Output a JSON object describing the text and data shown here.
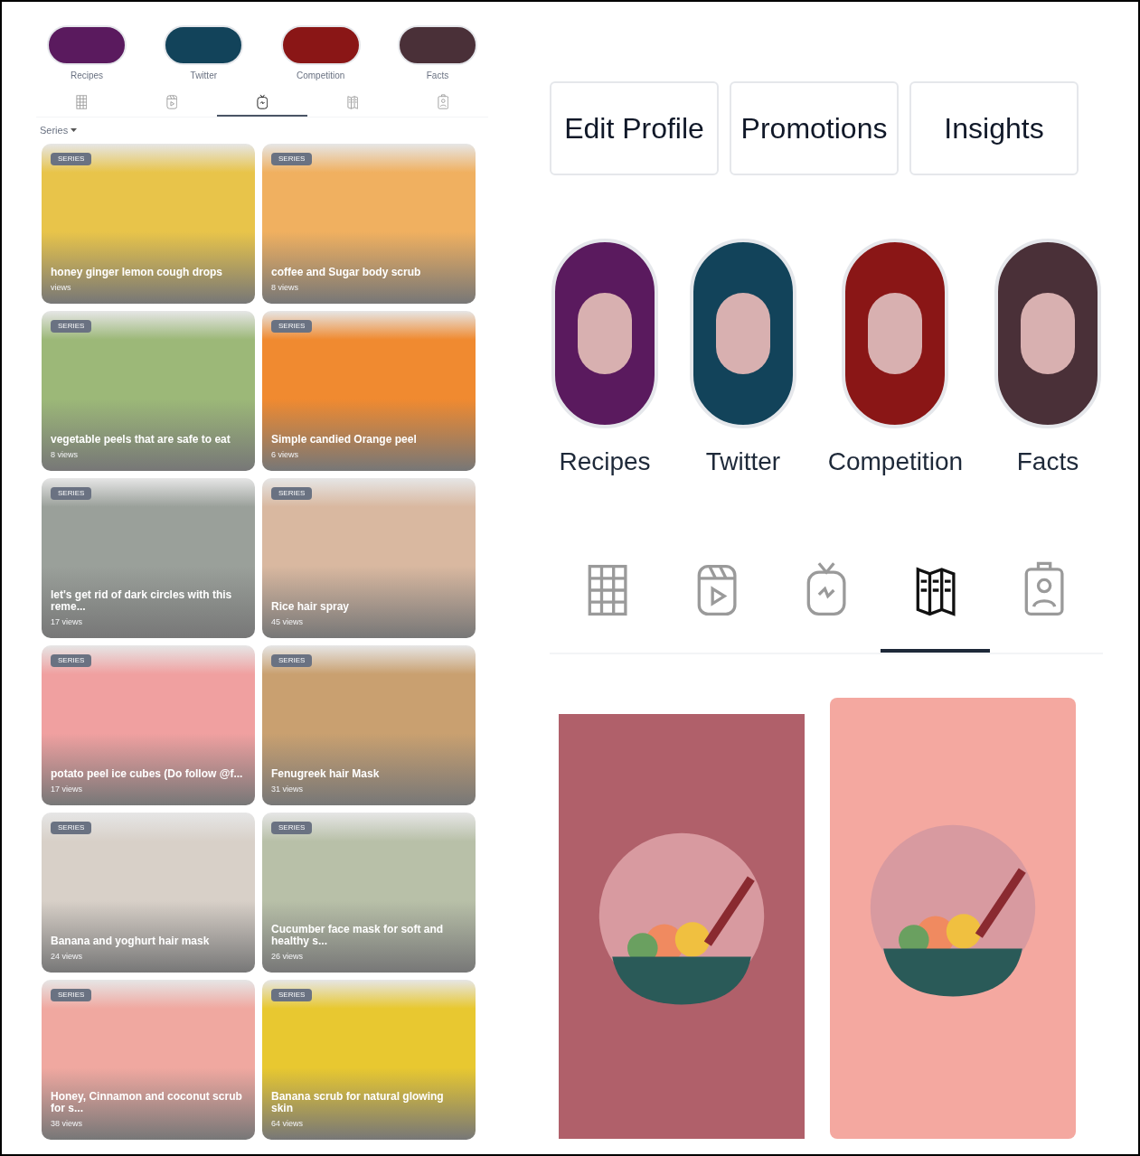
{
  "left": {
    "highlights": [
      {
        "label": "Recipes",
        "color": "#5a1a5e"
      },
      {
        "label": "Twitter",
        "color": "#12435a"
      },
      {
        "label": "Competition",
        "color": "#8a1616"
      },
      {
        "label": "Facts",
        "color": "#4a3038"
      }
    ],
    "tabs": [
      {
        "kind": "grid",
        "selected": false
      },
      {
        "kind": "reels",
        "selected": false
      },
      {
        "kind": "igtv",
        "selected": true
      },
      {
        "kind": "guides",
        "selected": false
      },
      {
        "kind": "tagged",
        "selected": false
      }
    ],
    "filter": "Series",
    "cards": [
      {
        "badge": "SERIES",
        "title": "honey ginger lemon cough drops",
        "views": "views",
        "color": "#e8c44a"
      },
      {
        "badge": "SERIES",
        "title": "coffee and Sugar body scrub",
        "views": "8 views",
        "color": "#f0b060"
      },
      {
        "badge": "SERIES",
        "title": "vegetable peels that are safe to eat",
        "views": "8 views",
        "color": "#9cb878"
      },
      {
        "badge": "SERIES",
        "title": "Simple candied Orange peel",
        "views": "6 views",
        "color": "#f08a30"
      },
      {
        "badge": "SERIES",
        "title": "let's get rid of dark circles with this reme...",
        "views": "17 views",
        "color": "#9aa09a"
      },
      {
        "badge": "SERIES",
        "title": "Rice hair spray",
        "views": "45 views",
        "color": "#d9b8a0"
      },
      {
        "badge": "SERIES",
        "title": "potato peel ice cubes (Do follow @f...",
        "views": "17 views",
        "color": "#f0a0a0"
      },
      {
        "badge": "SERIES",
        "title": "Fenugreek hair Mask",
        "views": "31 views",
        "color": "#c9a070"
      },
      {
        "badge": "SERIES",
        "title": "Banana and yoghurt hair mask",
        "views": "24 views",
        "color": "#d8d0c8"
      },
      {
        "badge": "SERIES",
        "title": "Cucumber face mask for soft and healthy s...",
        "views": "26 views",
        "color": "#b8c0a8"
      },
      {
        "badge": "SERIES",
        "title": "Honey, Cinnamon and coconut scrub for s...",
        "views": "38 views",
        "color": "#f0a8a0"
      },
      {
        "badge": "SERIES",
        "title": "Banana scrub for natural glowing skin",
        "views": "64 views",
        "color": "#e8c830"
      }
    ]
  },
  "right": {
    "buttons": [
      "Edit Profile",
      "Promotions",
      "Insights"
    ],
    "highlights": [
      {
        "label": "Recipes",
        "color": "#5a1a5e"
      },
      {
        "label": "Twitter",
        "color": "#12435a"
      },
      {
        "label": "Competition",
        "color": "#8a1616"
      },
      {
        "label": "Facts",
        "color": "#4a3038"
      }
    ],
    "tabs": [
      {
        "kind": "grid",
        "selected": false
      },
      {
        "kind": "reels",
        "selected": false
      },
      {
        "kind": "igtv",
        "selected": false
      },
      {
        "kind": "guides",
        "selected": true
      },
      {
        "kind": "tagged",
        "selected": false
      }
    ],
    "posts": [
      {
        "color": "#b0606a"
      },
      {
        "color": "#f4a8a0"
      }
    ]
  }
}
